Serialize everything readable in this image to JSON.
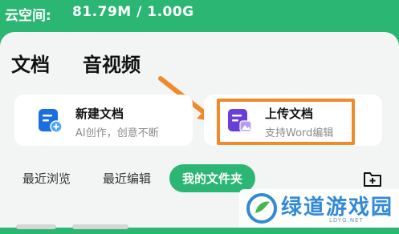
{
  "status": {
    "cloud_label": "云空间:",
    "cloud_value": "81.79M / 1.00G"
  },
  "tabs": [
    {
      "label": "文档",
      "selected": true
    },
    {
      "label": "音视频",
      "selected": false
    }
  ],
  "cards": {
    "new_doc": {
      "title": "新建文档",
      "subtitle": "AI创作，创意不断",
      "icon": "new-doc-icon",
      "icon_color": "#1a6fe0"
    },
    "upload_doc": {
      "title": "上传文档",
      "subtitle": "支持Word编辑",
      "icon": "upload-doc-icon",
      "icon_color": "#6a3fd8"
    }
  },
  "filters": {
    "recent_view": "最近浏览",
    "recent_edit": "最近编辑",
    "my_folder": "我的文件夹"
  },
  "watermark": {
    "text": "绿道游戏园",
    "sub": "LDYG.NET"
  },
  "colors": {
    "brand": "#2bb673",
    "highlight": "#f08a2a"
  }
}
